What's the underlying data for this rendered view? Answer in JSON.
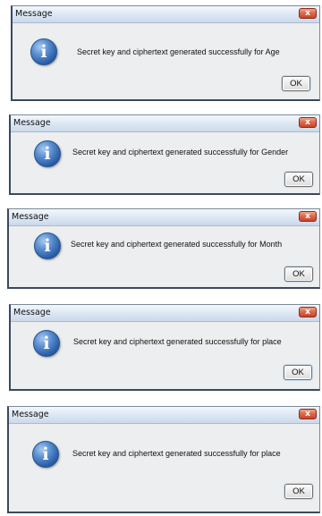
{
  "dialogs": [
    {
      "title": "Message",
      "close_label": "x",
      "icon_glyph": "i",
      "icon_name": "info-icon",
      "message": "Secret key and ciphertext generated successfully for Age",
      "ok_label": "OK"
    },
    {
      "title": "Message",
      "close_label": "x",
      "icon_glyph": "i",
      "icon_name": "info-icon",
      "message": "Secret key and ciphertext generated successfully for Gender",
      "ok_label": "OK"
    },
    {
      "title": "Message",
      "close_label": "x",
      "icon_glyph": "i",
      "icon_name": "info-icon",
      "message": "Secret key and ciphertext generated successfully for Month",
      "ok_label": "OK"
    },
    {
      "title": "Message",
      "close_label": "x",
      "icon_glyph": "i",
      "icon_name": "info-icon",
      "message": "Secret key and ciphertext generated successfully for place",
      "ok_label": "OK"
    },
    {
      "title": "Message",
      "close_label": "x",
      "icon_glyph": "i",
      "icon_name": "info-icon",
      "message": "Secret key and ciphertext generated successfully for place",
      "ok_label": "OK"
    }
  ],
  "colors": {
    "titlebar": "#dbe6f3",
    "close_button": "#de6a4a",
    "info_icon": "#2c5fa8",
    "dialog_body": "#eceeef"
  }
}
